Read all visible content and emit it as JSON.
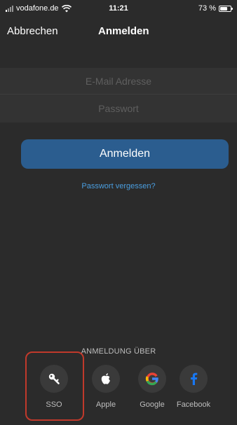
{
  "status": {
    "carrier": "vodafone.de",
    "time": "11:21",
    "battery": "73 %",
    "battery_level": 0.73
  },
  "nav": {
    "cancel_label": "Abbrechen",
    "title": "Anmelden"
  },
  "form": {
    "email_placeholder": "E-Mail Adresse",
    "email_value": "",
    "password_placeholder": "Passwort",
    "password_value": ""
  },
  "actions": {
    "login_label": "Anmelden",
    "forgot_label": "Passwort vergessen?"
  },
  "social": {
    "heading": "ANMELDUNG ÜBER",
    "providers": [
      {
        "label": "SSO",
        "icon": "key-icon"
      },
      {
        "label": "Apple",
        "icon": "apple-icon"
      },
      {
        "label": "Google",
        "icon": "google-icon"
      },
      {
        "label": "Facebook",
        "icon": "facebook-icon"
      }
    ]
  },
  "colors": {
    "background": "#2b2b2b",
    "primary_button": "#2b5d8f",
    "link": "#4a9ee0",
    "highlight": "#c0392b",
    "facebook": "#1877f2"
  }
}
